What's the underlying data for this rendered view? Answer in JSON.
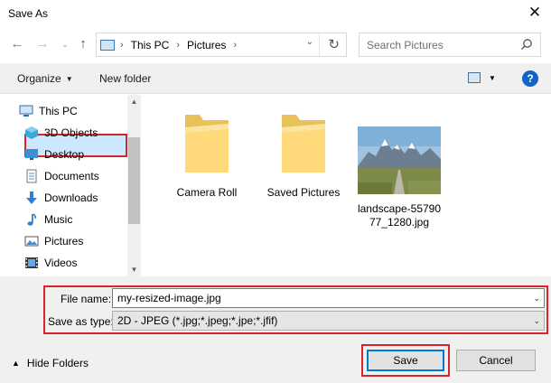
{
  "window": {
    "title": "Save As"
  },
  "address": {
    "crumbs": [
      "This PC",
      "Pictures"
    ]
  },
  "search": {
    "placeholder": "Search Pictures"
  },
  "toolbar": {
    "organize": "Organize",
    "new_folder": "New folder"
  },
  "nav": {
    "items": [
      {
        "label": "This PC",
        "icon": "pc-icon"
      },
      {
        "label": "3D Objects",
        "icon": "cube-icon"
      },
      {
        "label": "Desktop",
        "icon": "desktop-icon"
      },
      {
        "label": "Documents",
        "icon": "document-icon"
      },
      {
        "label": "Downloads",
        "icon": "download-arrow-icon"
      },
      {
        "label": "Music",
        "icon": "music-note-icon"
      },
      {
        "label": "Pictures",
        "icon": "picture-icon"
      },
      {
        "label": "Videos",
        "icon": "video-icon"
      }
    ],
    "selected": "Pictures"
  },
  "files": [
    {
      "label": "Camera Roll",
      "type": "folder"
    },
    {
      "label": "Saved Pictures",
      "type": "folder"
    },
    {
      "label_line1": "landscape-55790",
      "label_line2": "77_1280.jpg",
      "type": "image"
    }
  ],
  "form": {
    "filename_label": "File name:",
    "filename_value": "my-resized-image.jpg",
    "type_label": "Save as type:",
    "type_value": "2D - JPEG (*.jpg;*.jpeg;*.jpe;*.jfif)"
  },
  "footer": {
    "hide_folders": "Hide Folders",
    "save": "Save",
    "cancel": "Cancel"
  },
  "colors": {
    "accent": "#0078d7",
    "highlight": "#d7262b",
    "selection": "#cce8ff",
    "help": "#1264c6"
  }
}
